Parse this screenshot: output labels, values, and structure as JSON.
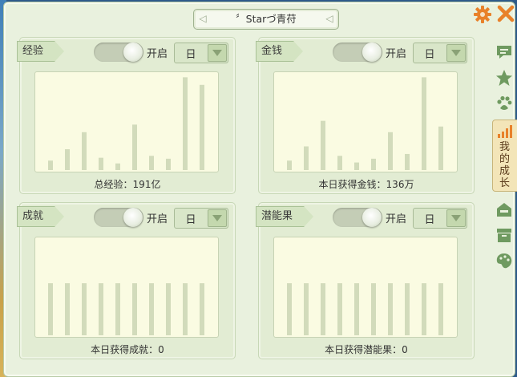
{
  "window": {
    "title": "〞Starづ青苻"
  },
  "panels": [
    {
      "tag": "经验",
      "toggle_label": "开启",
      "period": "日",
      "caption": "总经验：191亿",
      "bars": [
        0.1,
        0.22,
        0.4,
        0.13,
        0.07,
        0.48,
        0.15,
        0.12,
        0.98,
        0.9
      ]
    },
    {
      "tag": "金钱",
      "toggle_label": "开启",
      "period": "日",
      "caption": "本日获得金钱：136万",
      "bars": [
        0.1,
        0.25,
        0.52,
        0.15,
        0.08,
        0.12,
        0.4,
        0.17,
        0.98,
        0.46
      ]
    },
    {
      "tag": "成就",
      "toggle_label": "开启",
      "period": "日",
      "caption": "本日获得成就：0",
      "bars": [
        0.55,
        0.55,
        0.55,
        0.55,
        0.55,
        0.55,
        0.55,
        0.55,
        0.55,
        0.55
      ]
    },
    {
      "tag": "潜能果",
      "toggle_label": "开启",
      "period": "日",
      "caption": "本日获得潜能果：0",
      "bars": [
        0.55,
        0.55,
        0.55,
        0.55,
        0.55,
        0.55,
        0.55,
        0.55,
        0.55,
        0.55
      ]
    }
  ],
  "sidebar": {
    "icons": [
      "chat-icon",
      "star-icon",
      "paw-icon",
      "signal-bars-icon",
      "house-icon",
      "box-icon",
      "palette-icon"
    ],
    "active_tab": "我的成长"
  },
  "colors": {
    "bar": "#d2dbbb",
    "chart_bg": "#fafbe2",
    "active_tab": "#f3e5b8",
    "gear": "#e8812a",
    "close": "#e8812a"
  }
}
